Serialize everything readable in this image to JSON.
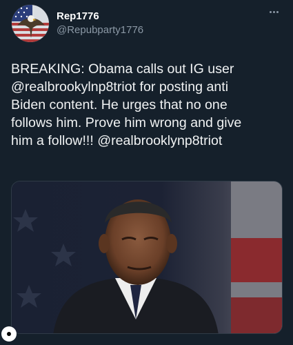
{
  "author": {
    "display_name": "Rep1776",
    "handle": "@Repubparty1776"
  },
  "tweet": {
    "lines": [
      "BREAKING: Obama calls out IG user",
      "@realbrookylnp8triot for posting anti",
      "Biden content. He urges that no one",
      "follows him. Prove him wrong and give",
      "him a follow!!! @realbrooklynp8triot"
    ]
  },
  "icons": {
    "more": "more-horizontal-icon",
    "avatar": "eagle-flag-avatar",
    "badge": "instagram-indicator-icon"
  },
  "colors": {
    "background": "#15202b",
    "text": "#e7e9ea",
    "secondary": "#8b98a5"
  }
}
